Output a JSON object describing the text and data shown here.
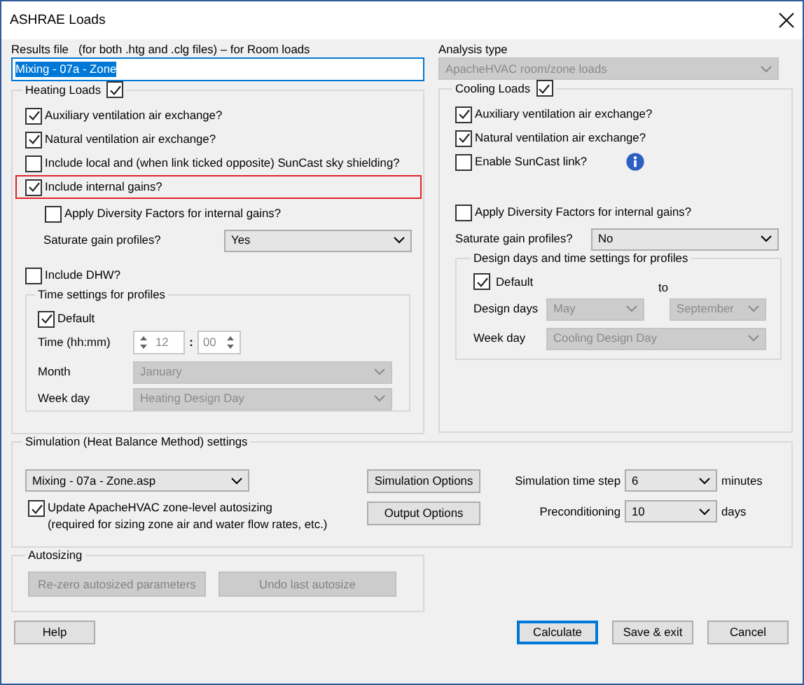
{
  "window": {
    "title": "ASHRAE Loads"
  },
  "results_file": {
    "label": "Results file   (for both .htg and .clg files) – for Room loads",
    "value": "Mixing - 07a - Zone",
    "text_selected": true
  },
  "analysis_type": {
    "label": "Analysis type",
    "value": "ApacheHVAC room/zone loads",
    "disabled": true
  },
  "heating_loads": {
    "label": "Heating Loads",
    "checked": true,
    "options": [
      {
        "label": "Auxiliary ventilation air exchange?",
        "checked": true,
        "highlighted": false
      },
      {
        "label": "Natural ventilation air exchange?",
        "checked": true,
        "highlighted": false
      },
      {
        "label": "Include local and (when link ticked opposite) SunCast sky shielding?",
        "checked": false,
        "highlighted": false
      },
      {
        "label": "Include internal gains?",
        "checked": true,
        "highlighted": true
      }
    ],
    "diversity": {
      "label": "Apply Diversity Factors for internal gains?",
      "checked": false
    },
    "saturate": {
      "label": "Saturate gain profiles?",
      "value": "Yes",
      "disabled": false
    },
    "dhw": {
      "label": "Include DHW?",
      "checked": false
    },
    "time_settings": {
      "label": "Time settings for profiles",
      "default": {
        "label": "Default",
        "checked": true
      },
      "time": {
        "label": "Time (hh:mm)",
        "hours": "12",
        "separator": ":",
        "minutes": "00",
        "disabled": true
      },
      "month": {
        "label": "Month",
        "value": "January",
        "disabled": true
      },
      "week_day": {
        "label": "Week day",
        "value": "Heating Design Day",
        "disabled": true
      }
    }
  },
  "cooling_loads": {
    "label": "Cooling Loads",
    "checked": true,
    "options": [
      {
        "kind": "checkbox",
        "label": "Auxiliary ventilation air exchange?",
        "checked": true
      },
      {
        "kind": "checkbox",
        "label": "Natural ventilation air exchange?",
        "checked": true
      },
      {
        "kind": "checkbox_info",
        "label": "Enable SunCast link?",
        "checked": false
      }
    ],
    "diversity": {
      "label": "Apply Diversity Factors for internal gains?",
      "checked": false
    },
    "saturate": {
      "label": "Saturate gain profiles?",
      "value": "No",
      "disabled": false
    },
    "design_days": {
      "label": "Design days and time settings for profiles",
      "default": {
        "label": "Default",
        "checked": true
      },
      "range": {
        "label": "Design days",
        "from": "May",
        "to_label": "to",
        "to": "September",
        "disabled": true
      },
      "week_day": {
        "label": "Week day",
        "value": "Cooling Design Day",
        "disabled": true
      }
    }
  },
  "simulation": {
    "label": "Simulation (Heat Balance Method) settings",
    "file": {
      "value": "Mixing - 07a - Zone.asp",
      "disabled": false
    },
    "update_autosizing": {
      "label": "Update ApacheHVAC zone-level autosizing\n(required for sizing zone air and water flow rates, etc.)",
      "checked": true
    },
    "buttons": [
      {
        "label": "Simulation Options",
        "disabled": false
      },
      {
        "label": "Output Options",
        "disabled": false
      }
    ],
    "time_step": {
      "label": "Simulation time step",
      "value": "6",
      "unit": "minutes"
    },
    "preconditioning": {
      "label": "Preconditioning",
      "value": "10",
      "unit": "days"
    }
  },
  "autosizing": {
    "label": "Autosizing",
    "buttons": [
      {
        "label": "Re-zero autosized parameters",
        "disabled": true
      },
      {
        "label": "Undo last autosize",
        "disabled": true
      }
    ]
  },
  "footer_buttons": [
    {
      "label": "Help",
      "default": false
    },
    {
      "label": "Calculate",
      "default": true
    },
    {
      "label": "Save & exit",
      "default": false
    },
    {
      "label": "Cancel",
      "default": false
    }
  ]
}
